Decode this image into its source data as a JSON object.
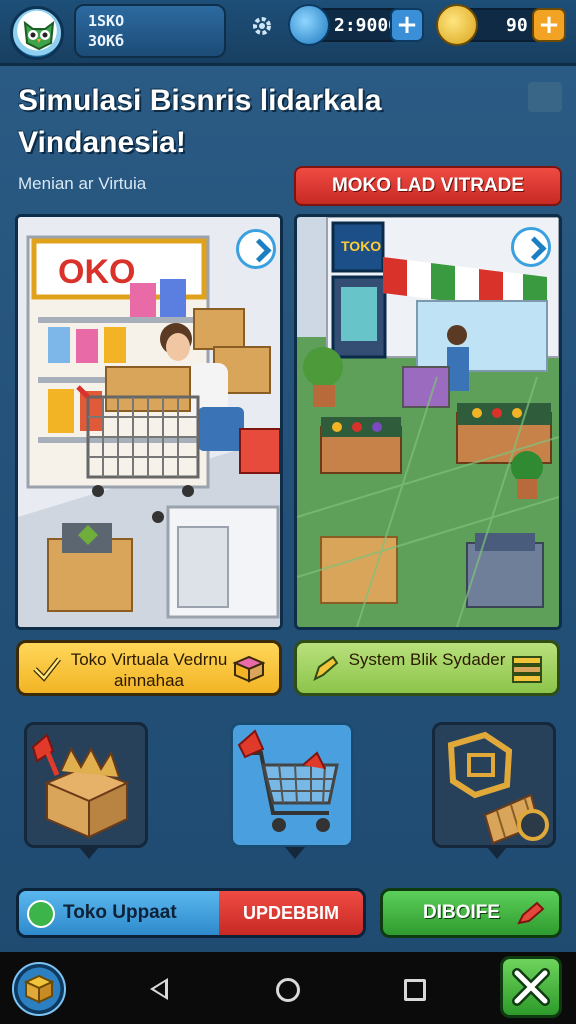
{
  "player": {
    "line1": "1SKO",
    "line2": "3OKб"
  },
  "resources": {
    "gems": "2:9000",
    "coins": "90"
  },
  "title": "Simulasi Bisnris lidarkala Vindanesia!",
  "subtitle": "Menian ar Virtuia",
  "main_action": "MOKO LAD VITRADE",
  "options": [
    {
      "label": "Toko Virtuala Vedrnu ainnahaa"
    },
    {
      "label": "System Blik Sydader"
    }
  ],
  "tiles": [
    "gift-box",
    "shopping-cart",
    "cash-register"
  ],
  "bottom": {
    "split_left": "Toko Uppaat",
    "split_right": "UPDEBBIM",
    "green": "DIBOIFE"
  },
  "colors": {
    "accent_red": "#d9342c",
    "accent_yellow": "#f2b424",
    "accent_green": "#8cc54b",
    "accent_blue": "#2f8acb"
  }
}
